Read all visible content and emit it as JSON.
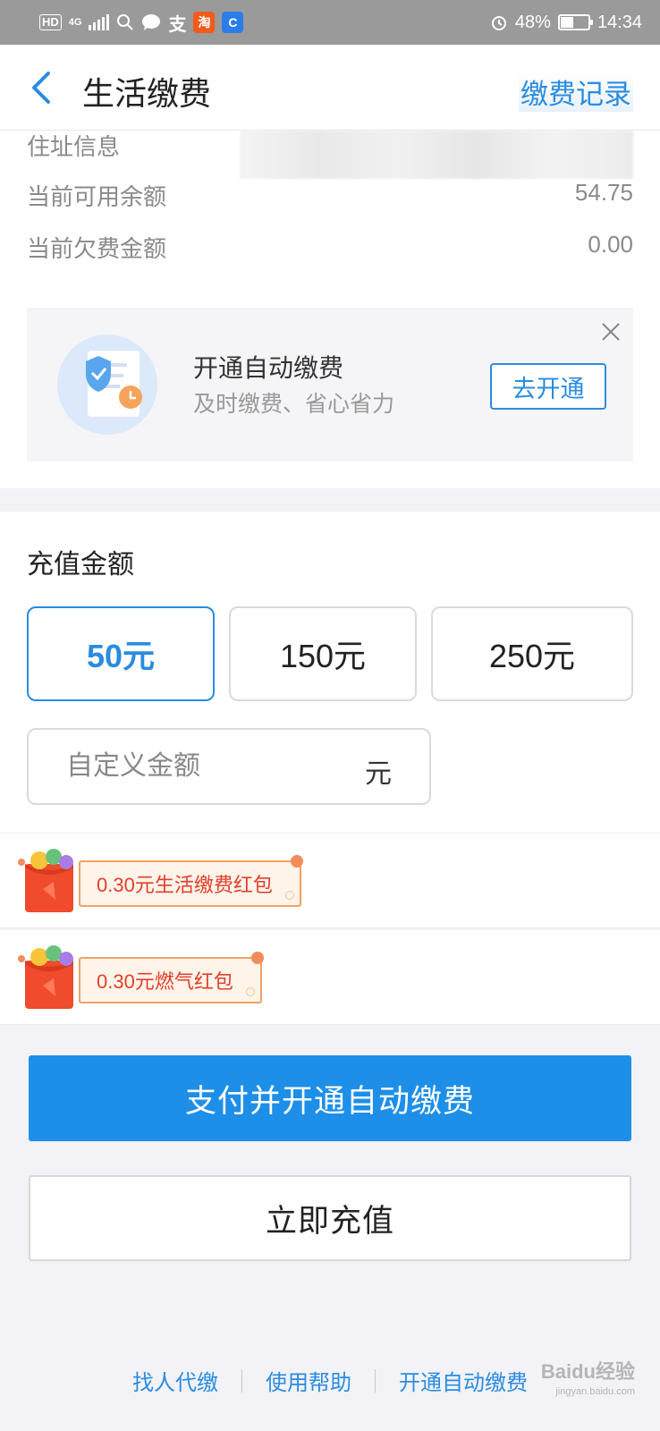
{
  "status_bar": {
    "network_chip": "HD",
    "network_type": "4G",
    "app_icons": [
      {
        "name": "search-icon",
        "glyph": "○"
      },
      {
        "name": "chat-icon",
        "glyph": "●"
      },
      {
        "name": "alipay-icon",
        "glyph": "支"
      },
      {
        "name": "taobao-icon",
        "glyph": "淘"
      },
      {
        "name": "app-icon",
        "glyph": "C"
      }
    ],
    "battery": "48%",
    "battery_level": 0.48,
    "time": "14:34"
  },
  "nav": {
    "title": "生活缴费",
    "record_link": "缴费记录"
  },
  "info": {
    "rows": [
      {
        "label": "住址信息",
        "value": ""
      },
      {
        "label": "当前可用余额",
        "value": "54.75"
      },
      {
        "label": "当前欠费金额",
        "value": "0.00"
      }
    ]
  },
  "promo": {
    "title": "开通自动缴费",
    "subtitle": "及时缴费、省心省力",
    "button": "去开通"
  },
  "recharge": {
    "title": "充值金额",
    "options": [
      {
        "label": "50元",
        "selected": true
      },
      {
        "label": "150元",
        "selected": false
      },
      {
        "label": "250元",
        "selected": false
      }
    ],
    "custom_placeholder": "自定义金额",
    "custom_unit": "元"
  },
  "red_packets": [
    {
      "label": "0.30元生活缴费红包"
    },
    {
      "label": "0.30元燃气红包"
    }
  ],
  "actions": {
    "primary": "支付并开通自动缴费",
    "secondary": "立即充值"
  },
  "footer": {
    "links": [
      "找人代缴",
      "使用帮助",
      "开通自动缴费"
    ]
  },
  "watermark": {
    "text": "Baidu经验",
    "sub": "jingyan.baidu.com"
  },
  "colors": {
    "accent": "#1e8fe8",
    "link": "#2a8ce0",
    "red_packet_text": "#e23f2a"
  }
}
